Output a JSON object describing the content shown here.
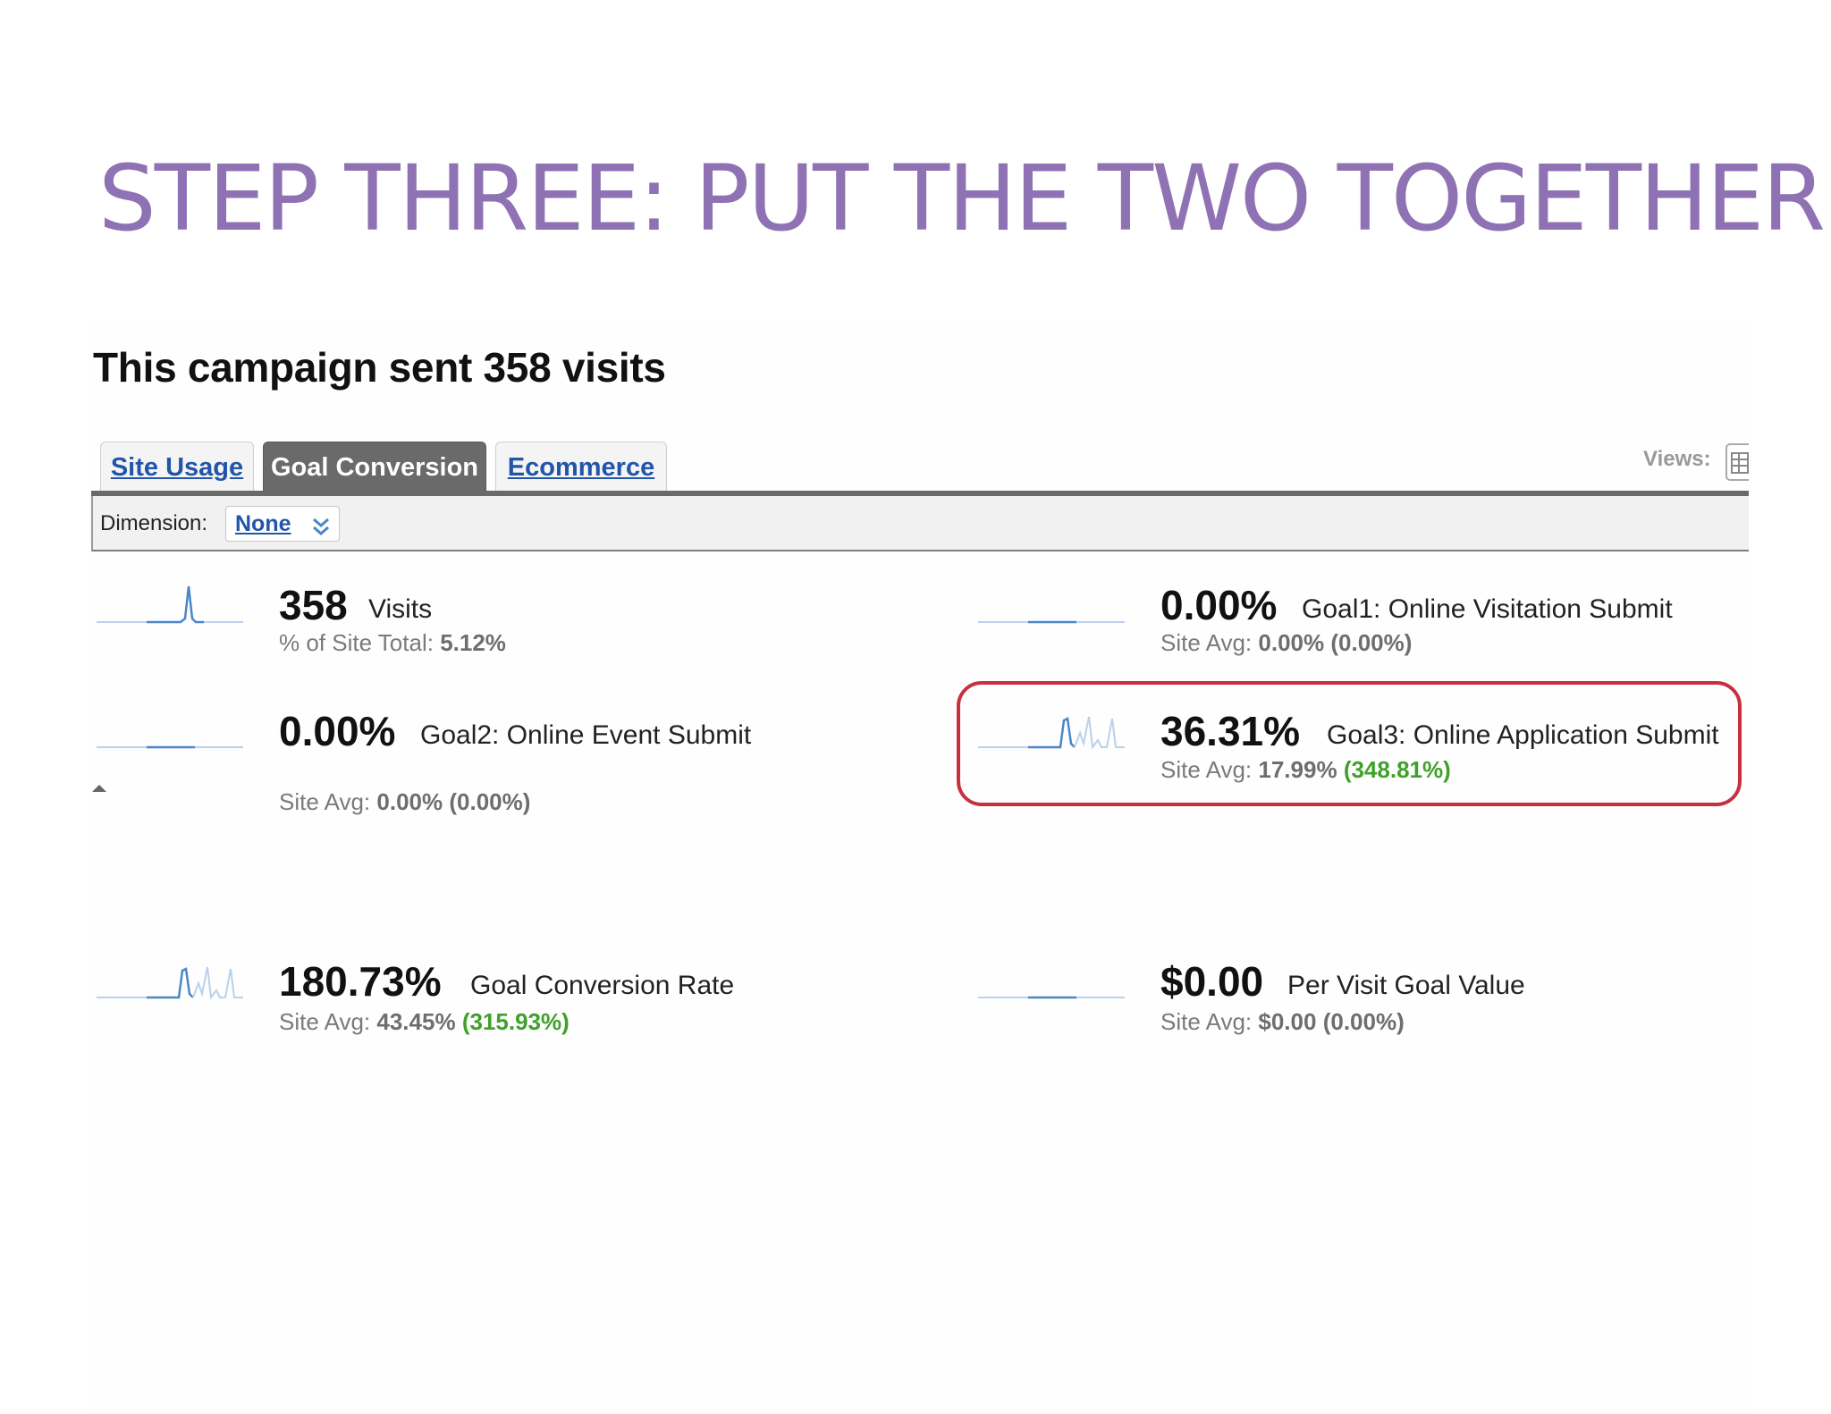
{
  "slide": {
    "title": "STEP THREE: PUT THE TWO TOGETHER"
  },
  "report": {
    "heading": "This campaign sent 358 visits",
    "tabs": [
      {
        "label": "Site Usage",
        "active": false
      },
      {
        "label": "Goal Conversion",
        "active": true
      },
      {
        "label": "Ecommerce",
        "active": false
      }
    ],
    "views_label": "Views:",
    "dimension": {
      "label": "Dimension:",
      "value": "None"
    }
  },
  "metrics": {
    "visits": {
      "value": "358",
      "label": "Visits",
      "sub_label": "% of Site Total:",
      "sub_value": "5.12%"
    },
    "goal1": {
      "value": "0.00%",
      "label": "Goal1: Online Visitation Submit",
      "sub_label": "Site Avg:",
      "sub_value": "0.00%",
      "sub_change": "(0.00%)"
    },
    "goal2": {
      "value": "0.00%",
      "label": "Goal2: Online Event Submit",
      "sub_label": "Site Avg:",
      "sub_value": "0.00%",
      "sub_change": "(0.00%)"
    },
    "goal3": {
      "value": "36.31%",
      "label": "Goal3: Online Application Submit",
      "sub_label": "Site Avg:",
      "sub_value": "17.99%",
      "sub_change": "(348.81%)"
    },
    "conversion_rate": {
      "value": "180.73%",
      "label": "Goal Conversion Rate",
      "sub_label": "Site Avg:",
      "sub_value": "43.45%",
      "sub_change": "(315.93%)"
    },
    "goal_value": {
      "value": "$0.00",
      "label": "Per Visit Goal Value",
      "sub_label": "Site Avg:",
      "sub_value": "$0.00",
      "sub_change": "(0.00%)"
    }
  },
  "colors": {
    "title": "#8f72b3",
    "link": "#2255aa",
    "positive": "#3fa12a",
    "highlight": "#c8303f",
    "sparkline": "#4a86c8"
  },
  "icons": [
    "grid-view-icon",
    "chevron-down-icon",
    "collapse-arrow-icon"
  ]
}
